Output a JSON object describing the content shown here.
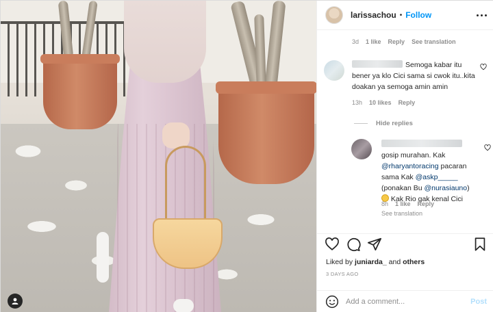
{
  "header": {
    "username": "larissachou",
    "separator": "•",
    "follow_label": "Follow"
  },
  "top_comment_meta": {
    "time": "3d",
    "likes": "1 like",
    "reply": "Reply",
    "translate": "See translation"
  },
  "comment1": {
    "text": "Semoga kabar itu bener ya klo Cici sama si cwok itu..kita doakan ya semoga amin amin",
    "time": "13h",
    "likes": "10 likes",
    "reply": "Reply"
  },
  "hide_replies_label": "Hide replies",
  "comment2": {
    "part1": "gosip murahan. Kak",
    "mention1": "@rharyantoracing",
    "part2": " pacaran sama Kak ",
    "mention2": "@askp_____",
    "part3": "(ponakan Bu ",
    "mention3": "@nurasiauno",
    "part4": ")",
    "part5": " Kak Rio gak kenal Cici",
    "time": "8h",
    "likes": "1 like",
    "reply": "Reply",
    "translate": "See translation"
  },
  "likes_line": {
    "prefix": "Liked by ",
    "user": "juniarda_",
    "and": " and ",
    "others": "others"
  },
  "time_ago": "3 DAYS AGO",
  "add_comment": {
    "placeholder": "Add a comment...",
    "post_label": "Post"
  },
  "colors": {
    "accent": "#0095f6",
    "post_disabled": "#b2dffc",
    "muted": "#8e8e8e",
    "mention": "#00376b"
  },
  "icons": [
    "heart-icon",
    "comment-icon",
    "share-icon",
    "bookmark-icon",
    "emoji-icon",
    "user-tag-icon",
    "more-icon"
  ]
}
